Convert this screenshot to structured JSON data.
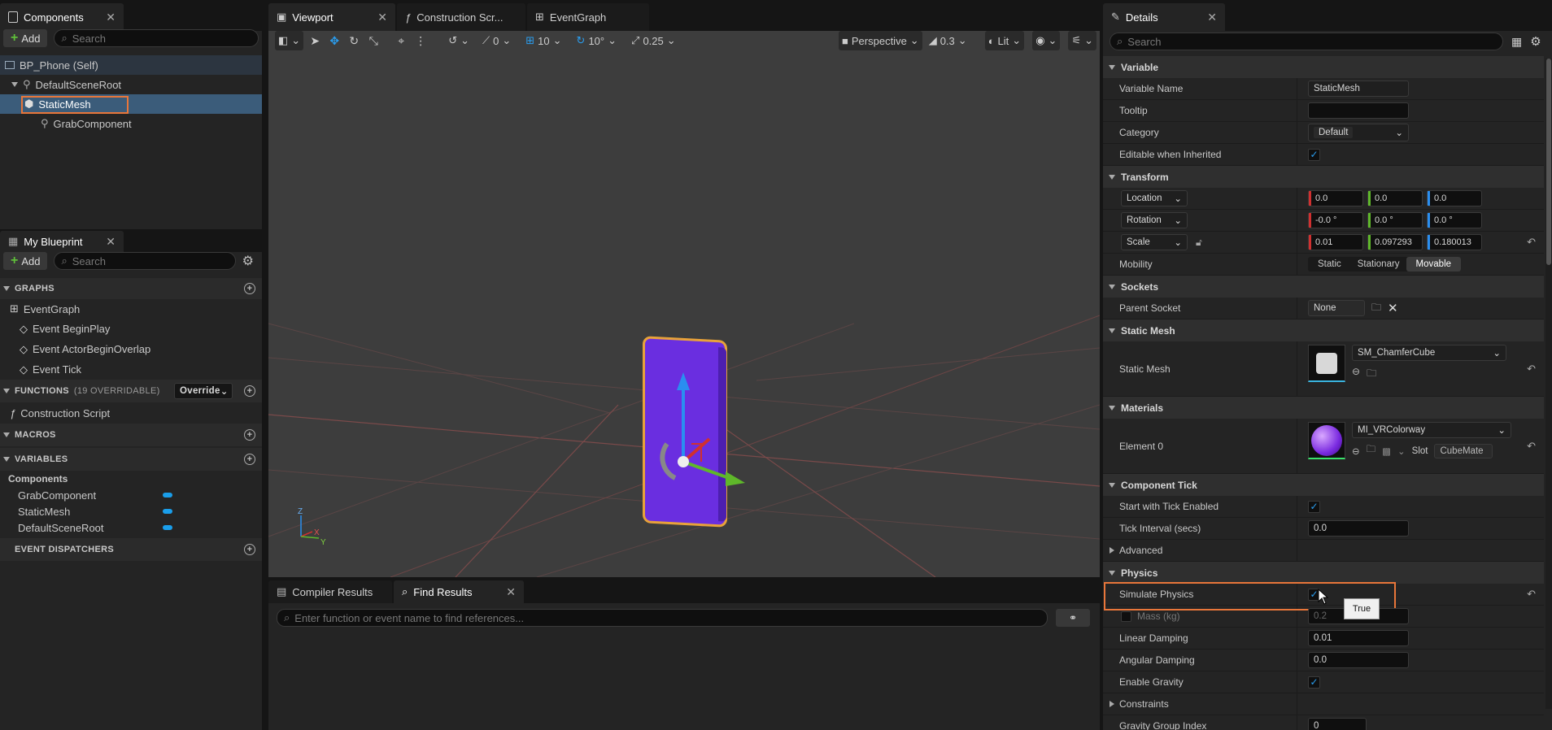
{
  "components_panel": {
    "tab_label": "Components",
    "add_label": "Add",
    "search_placeholder": "Search",
    "tree": {
      "self": "BP_Phone (Self)",
      "root": "DefaultSceneRoot",
      "static_mesh": "StaticMesh",
      "grab": "GrabComponent"
    }
  },
  "my_blueprint": {
    "tab_label": "My Blueprint",
    "add_label": "Add",
    "search_placeholder": "Search",
    "graphs_header": "GRAPHS",
    "event_graph": "EventGraph",
    "events": [
      "Event BeginPlay",
      "Event ActorBeginOverlap",
      "Event Tick"
    ],
    "functions_header": "FUNCTIONS",
    "functions_count": "(19 OVERRIDABLE)",
    "override_label": "Override",
    "construction_script": "Construction Script",
    "macros_header": "MACROS",
    "variables_header": "VARIABLES",
    "components_group": "Components",
    "variables": [
      "GrabComponent",
      "StaticMesh",
      "DefaultSceneRoot"
    ],
    "dispatchers_header": "EVENT DISPATCHERS"
  },
  "editor_tabs": {
    "viewport": "Viewport",
    "construction": "Construction Scr...",
    "eventgraph": "EventGraph"
  },
  "viewport_toolbar": {
    "rotate_snap_val": "0",
    "grid_val": "10",
    "rot_val": "10°",
    "scale_val": "0.25",
    "perspective": "Perspective",
    "speed": "0.3",
    "lit": "Lit"
  },
  "axis_labels": {
    "z": "Z",
    "x": "X",
    "y": "Y"
  },
  "bottom_tabs": {
    "compiler": "Compiler Results",
    "find": "Find Results",
    "find_placeholder": "Enter function or event name to find references..."
  },
  "details": {
    "tab_label": "Details",
    "search_placeholder": "Search",
    "variable_section": "Variable",
    "variable_name_label": "Variable Name",
    "variable_name": "StaticMesh",
    "tooltip_label": "Tooltip",
    "tooltip_value": "",
    "category_label": "Category",
    "category_value": "Default",
    "editable_label": "Editable when Inherited",
    "transform_section": "Transform",
    "location_label": "Location",
    "location": [
      "0.0",
      "0.0",
      "0.0"
    ],
    "rotation_label": "Rotation",
    "rotation": [
      "-0.0 °",
      "0.0 °",
      "0.0 °"
    ],
    "scale_label": "Scale",
    "scale": [
      "0.01",
      "0.097293",
      "0.180013"
    ],
    "mobility_label": "Mobility",
    "mobility_options": [
      "Static",
      "Stationary",
      "Movable"
    ],
    "sockets_section": "Sockets",
    "parent_socket_label": "Parent Socket",
    "parent_socket_value": "None",
    "static_mesh_section": "Static Mesh",
    "static_mesh_label": "Static Mesh",
    "static_mesh_value": "SM_ChamferCube",
    "materials_section": "Materials",
    "element0_label": "Element 0",
    "material_value": "MI_VRColorway",
    "slot_label": "Slot",
    "slot_value": "CubeMate",
    "component_tick_section": "Component Tick",
    "start_tick_label": "Start with Tick Enabled",
    "tick_interval_label": "Tick Interval (secs)",
    "tick_interval_value": "0.0",
    "advanced_label": "Advanced",
    "physics_section": "Physics",
    "simulate_label": "Simulate Physics",
    "mass_label": "Mass (kg)",
    "mass_value": "0.2",
    "tooltip_true": "True",
    "linear_damping_label": "Linear Damping",
    "linear_damping_value": "0.01",
    "angular_damping_label": "Angular Damping",
    "angular_damping_value": "0.0",
    "gravity_label": "Enable Gravity",
    "constraints_label": "Constraints",
    "gravity_group_label": "Gravity Group Index",
    "gravity_group_value": "0"
  },
  "colors": {
    "accent": "#e8763a",
    "selection": "#3b5c7a",
    "check": "#2a9ef0",
    "phone": "#6a2ee0"
  }
}
